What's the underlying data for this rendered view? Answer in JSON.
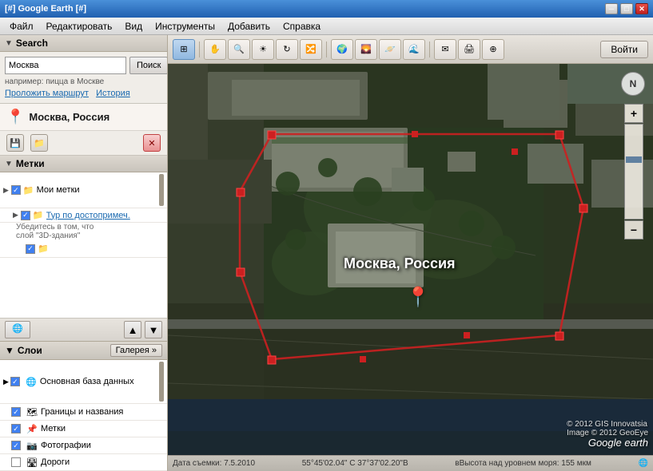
{
  "window": {
    "title": "[#] Google Earth [#]",
    "minimize_label": "─",
    "maximize_label": "□",
    "close_label": "✕"
  },
  "menu": {
    "items": [
      "Файл",
      "Редактировать",
      "Вид",
      "Инструменты",
      "Добавить",
      "Справка"
    ]
  },
  "toolbar": {
    "login_label": "Войти"
  },
  "search": {
    "title": "Search",
    "input_value": "Москва",
    "button_label": "Поиск",
    "hint": "например: пицца в Москве",
    "route_link": "Проложить маршрут",
    "history_link": "История",
    "result_name": "Москва, Россия"
  },
  "marks": {
    "title": "Метки",
    "my_marks": "Мои метки",
    "tour_item": "Тур по достопримеч.",
    "tour_hint": "Убедитесь в том, что",
    "tour_hint2": "слой \"3D-здания\"",
    "nav_prev": "◄",
    "nav_up": "▲",
    "nav_down": "▼"
  },
  "layers": {
    "title": "Слои",
    "gallery_label": "Галерея »",
    "items": [
      {
        "label": "Основная база данных",
        "checked": true,
        "icon": "🌐"
      },
      {
        "label": "Границы и названия",
        "checked": true,
        "icon": "🗺"
      },
      {
        "label": "Метки",
        "checked": true,
        "icon": "📌"
      },
      {
        "label": "Фотографии",
        "checked": true,
        "icon": "📷"
      },
      {
        "label": "Дороги",
        "checked": false,
        "icon": "🛣"
      }
    ]
  },
  "map": {
    "label": "Москва, Россия",
    "copyright1": "© 2012 GIS Innovatsia",
    "copyright2": "Image © 2012 GeoEye",
    "logo": "Google earth"
  },
  "status": {
    "date": "Дата съемки: 7.5.2010",
    "coords": "55°45'02.04\" С  37°37'02.20\"В",
    "elevation": "вВысота над уровнем моря:  155 мкм"
  },
  "icons": {
    "save": "💾",
    "folder": "📁",
    "close": "✕",
    "arrow_left": "◄",
    "arrow_up": "▲",
    "arrow_down": "▼",
    "globe_nav": "🌐",
    "pin": "📍",
    "zoom_plus": "+",
    "zoom_minus": "−",
    "north": "N"
  }
}
